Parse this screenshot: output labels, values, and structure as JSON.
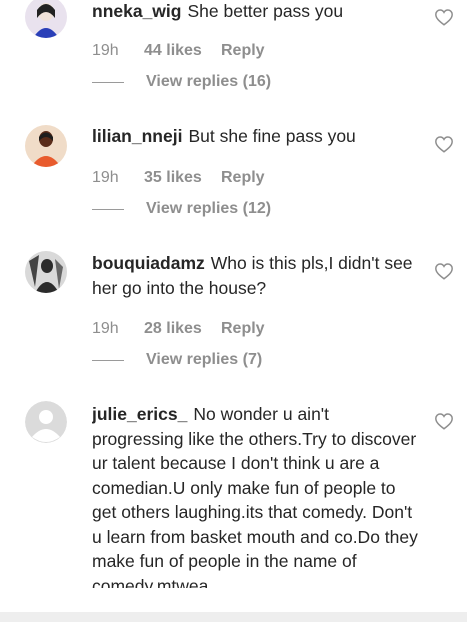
{
  "comments": [
    {
      "username": "nneka_wig",
      "text": "She better pass you",
      "time": "19h",
      "likes": "44 likes",
      "reply": "Reply",
      "view_replies": "View replies (16)",
      "avatar_colors": [
        "#2a3fb8",
        "#f0e2d8"
      ]
    },
    {
      "username": "lilian_nneji",
      "text": "But she fine pass you",
      "time": "19h",
      "likes": "35 likes",
      "reply": "Reply",
      "view_replies": "View replies (12)",
      "avatar_colors": [
        "#e85b2d",
        "#5a2c1a"
      ]
    },
    {
      "username": "bouquiadamz",
      "text": "Who is this pls,I didn't see her go into the house?",
      "time": "19h",
      "likes": "28 likes",
      "reply": "Reply",
      "view_replies": "View replies (7)",
      "avatar_colors": [
        "#d9d9d9",
        "#2b2b2b"
      ]
    },
    {
      "username": "julie_erics_",
      "text": "No wonder u ain't progressing like the others.Try to discover ur talent because I don't think u are a comedian.U only make fun of people to get others laughing.its that comedy. Don't u learn from basket mouth and co.Do they make fun of people in the name of comedy.mtwea",
      "avatar_colors": [
        "#dbdbdb",
        "#ffffff"
      ]
    }
  ]
}
